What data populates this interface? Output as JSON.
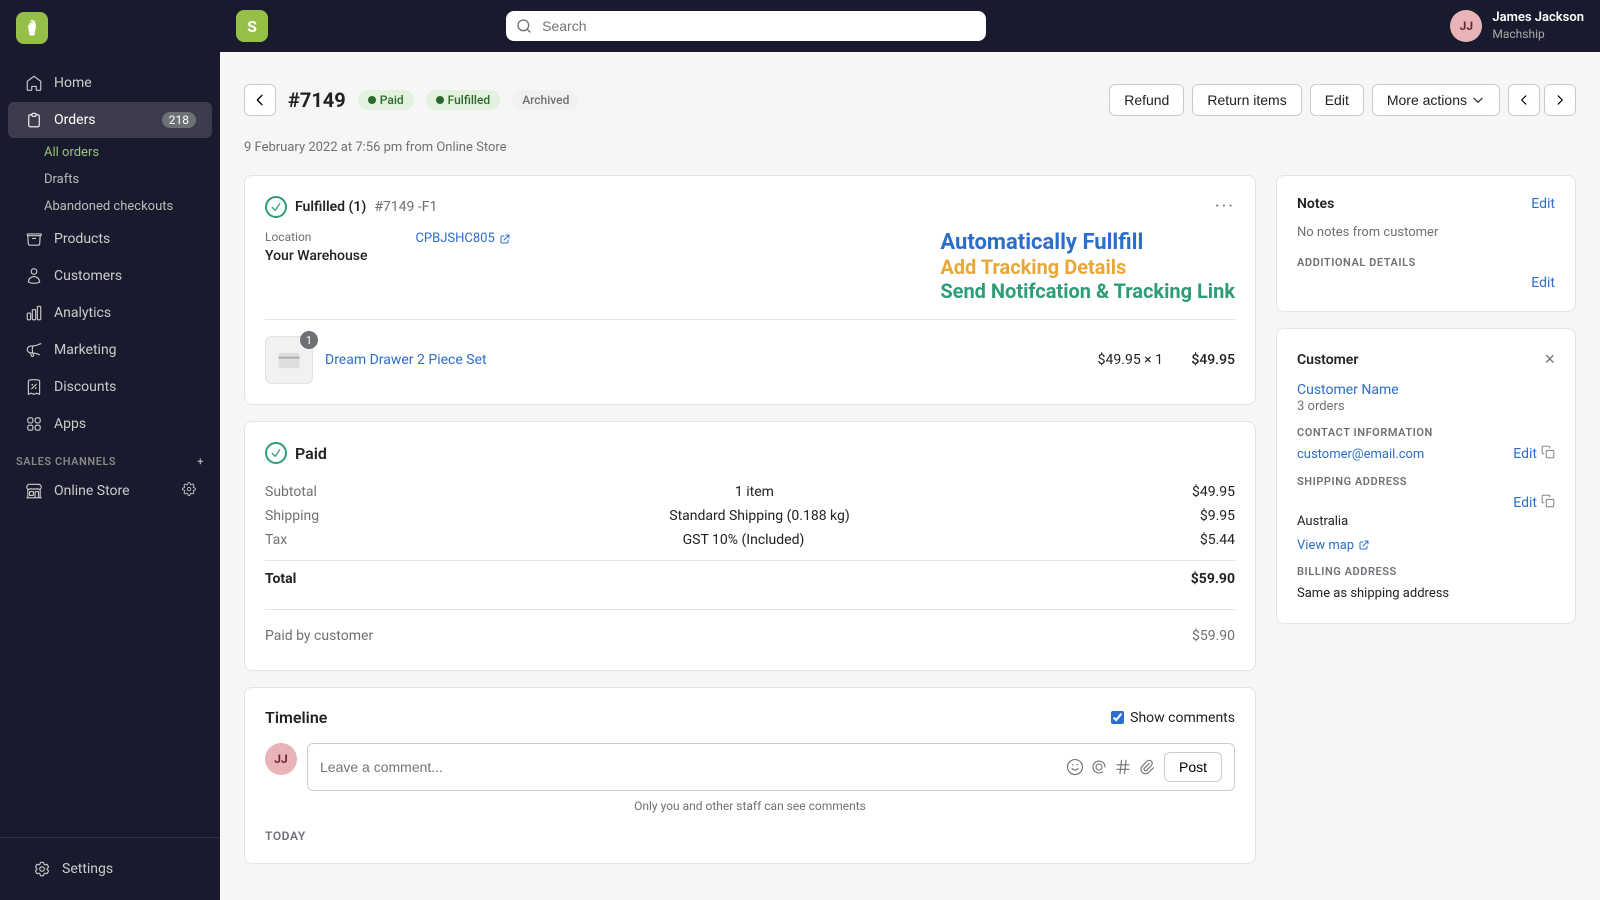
{
  "app": {
    "title": "Shopify Admin",
    "logo_text": "S"
  },
  "topbar": {
    "search_placeholder": "Search",
    "user_initials": "JJ",
    "user_name": "James Jackson",
    "user_store": "Machship"
  },
  "sidebar": {
    "nav_items": [
      {
        "id": "home",
        "label": "Home",
        "icon": "home"
      },
      {
        "id": "orders",
        "label": "Orders",
        "icon": "orders",
        "badge": "218"
      },
      {
        "id": "products",
        "label": "Products",
        "icon": "products"
      },
      {
        "id": "customers",
        "label": "Customers",
        "icon": "customers"
      },
      {
        "id": "analytics",
        "label": "Analytics",
        "icon": "analytics"
      },
      {
        "id": "marketing",
        "label": "Marketing",
        "icon": "marketing"
      },
      {
        "id": "discounts",
        "label": "Discounts",
        "icon": "discounts"
      },
      {
        "id": "apps",
        "label": "Apps",
        "icon": "apps"
      }
    ],
    "sub_items": [
      {
        "id": "all-orders",
        "label": "All orders",
        "active": true
      },
      {
        "id": "drafts",
        "label": "Drafts"
      },
      {
        "id": "abandoned-checkouts",
        "label": "Abandoned checkouts"
      }
    ],
    "sales_channels_label": "SALES CHANNELS",
    "sales_channels": [
      {
        "id": "online-store",
        "label": "Online Store"
      }
    ],
    "settings_label": "Settings"
  },
  "page": {
    "back_label": "Back",
    "order_number": "#7149",
    "status_paid": "Paid",
    "status_fulfilled": "Fulfilled",
    "status_archived": "Archived",
    "timestamp": "9 February 2022 at 7:56 pm from Online Store",
    "actions": {
      "refund": "Refund",
      "return_items": "Return items",
      "edit": "Edit",
      "more_actions": "More actions"
    }
  },
  "fulfillment_card": {
    "title": "Fulfilled (1)",
    "order_ref": "#7149 -F1",
    "location_label": "Location",
    "location_value": "Your Warehouse",
    "tracking_code": "CPBJSHC805",
    "cta_auto": "Automatically Fullfill",
    "cta_tracking": "Add Tracking Details",
    "cta_notification": "Send Notifcation & Tracking Link",
    "product_name": "Dream Drawer 2 Piece Set",
    "product_qty": "1",
    "product_unit_price": "$49.95 × 1",
    "product_total": "$49.95"
  },
  "payment_card": {
    "paid_label": "Paid",
    "subtotal_label": "Subtotal",
    "subtotal_qty": "1 item",
    "subtotal_amount": "$49.95",
    "shipping_label": "Shipping",
    "shipping_desc": "Standard Shipping (0.188 kg)",
    "shipping_amount": "$9.95",
    "tax_label": "Tax",
    "tax_desc": "GST 10% (Included)",
    "tax_amount": "$5.44",
    "total_label": "Total",
    "total_amount": "$59.90",
    "paid_by_label": "Paid by customer",
    "paid_by_amount": "$59.90"
  },
  "timeline": {
    "title": "Timeline",
    "show_comments_label": "Show comments",
    "comment_placeholder": "Leave a comment...",
    "post_label": "Post",
    "staff_note": "Only you and other staff can see comments",
    "today_label": "TODAY"
  },
  "notes_card": {
    "title": "Notes",
    "edit_label": "Edit",
    "no_notes": "No notes from customer",
    "additional_details_label": "ADDITIONAL DETAILS",
    "additional_edit_label": "Edit"
  },
  "customer_card": {
    "title": "Customer",
    "customer_name": "Customer Name",
    "orders_count": "3 orders",
    "contact_info_label": "CONTACT INFORMATION",
    "contact_edit_label": "Edit",
    "email": "customer@email.com",
    "shipping_address_label": "SHIPPING ADDRESS",
    "shipping_edit_label": "Edit",
    "country": "Australia",
    "view_map_label": "View map",
    "billing_address_label": "BILLING ADDRESS",
    "billing_address_value": "Same as shipping address"
  }
}
